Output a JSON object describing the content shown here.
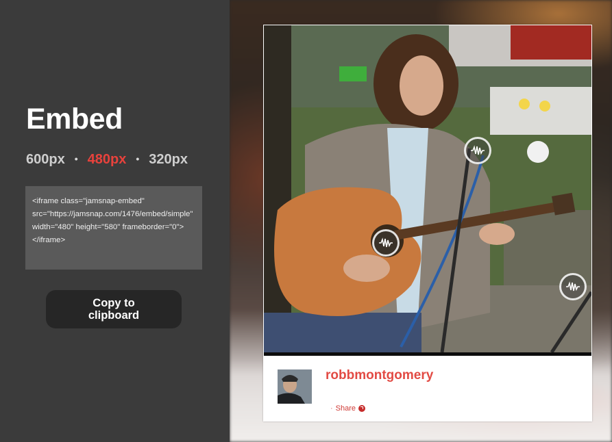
{
  "embed_panel": {
    "title": "Embed",
    "sizes": [
      {
        "label": "600px",
        "active": false
      },
      {
        "label": "480px",
        "active": true
      },
      {
        "label": "320px",
        "active": false
      }
    ],
    "separator": "•",
    "embed_code": "<iframe class=\"jamsnap-embed\" src=\"https://jamsnap.com/1476/embed/simple\" width=\"480\" height=\"580\" frameborder=\"0\"></iframe>",
    "copy_button_label": "Copy to clipboard"
  },
  "card": {
    "username": "robbmontgomery",
    "share_label": "Share",
    "hotspot_icon": "waveform-icon",
    "hotspot_count": 3
  },
  "colors": {
    "accent": "#e8423c",
    "panel_bg": "#3b3b3b",
    "button_bg": "#262626",
    "code_bg": "#5a5a5a"
  }
}
